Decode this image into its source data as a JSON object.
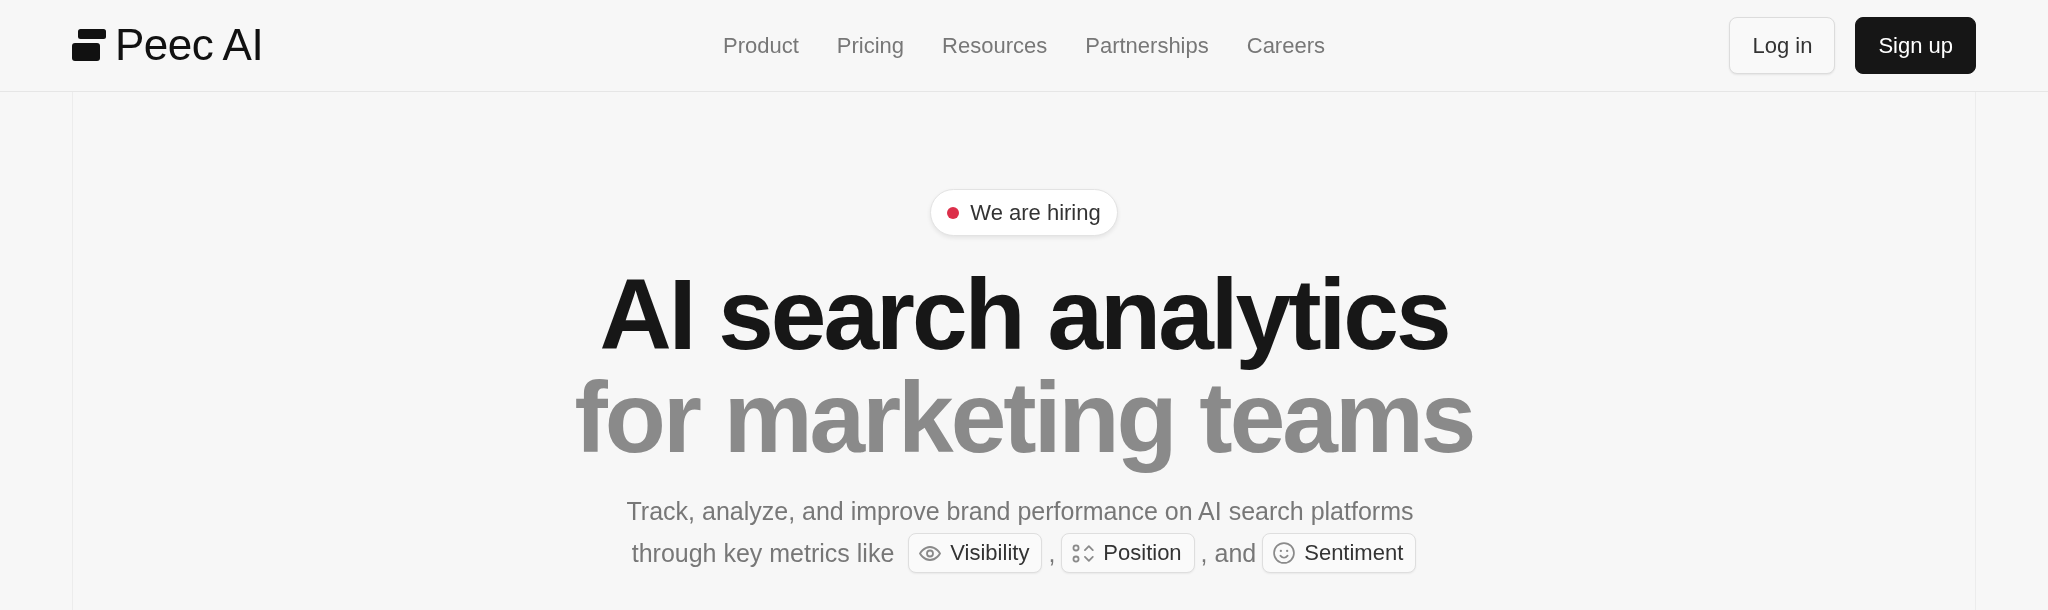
{
  "header": {
    "logo": "Peec AI",
    "nav": [
      "Product",
      "Pricing",
      "Resources",
      "Partnerships",
      "Careers"
    ],
    "buttons": [
      {
        "label": "Log in",
        "kind": "outline"
      },
      {
        "label": "Sign up",
        "kind": "filled"
      }
    ]
  },
  "hero": {
    "badge": "We are hiring",
    "headline": [
      {
        "text": "AI search analytics",
        "kind": "lead"
      },
      {
        "text": "for marketing teams",
        "kind": "muted"
      }
    ],
    "subtitle": [
      {
        "segments": [
          {
            "kind": "text",
            "text": "Track, analyze, and improve brand performance on AI search platforms"
          }
        ]
      },
      {
        "segments": [
          {
            "kind": "text",
            "text": "through key metrics like"
          },
          {
            "kind": "chip",
            "text": "Visibility"
          },
          {
            "kind": "text",
            "text": ","
          },
          {
            "kind": "chip",
            "text": "Position"
          },
          {
            "kind": "text",
            "text": ", and"
          },
          {
            "kind": "chip",
            "text": "Sentiment"
          }
        ]
      }
    ]
  }
}
